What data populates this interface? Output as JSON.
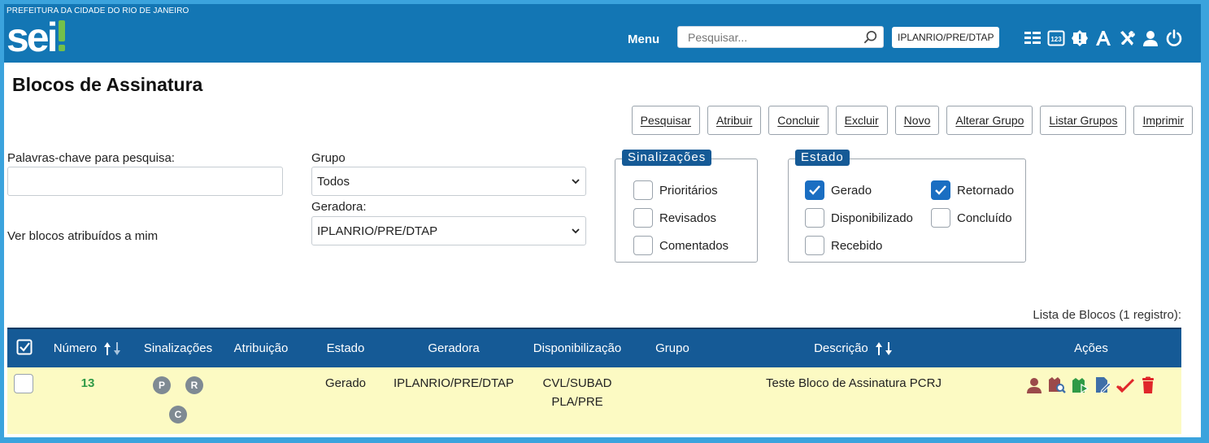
{
  "header": {
    "org_name": "PREFEITURA DA CIDADE DO RIO DE JANEIRO",
    "logo_text": "sei!",
    "menu_label": "Menu",
    "search_placeholder": "Pesquisar...",
    "unit": "IPLANRIO/PRE/DTAP",
    "icons": [
      "list-icon",
      "numeric-icon",
      "badge-alert-icon",
      "font-icon",
      "tools-icon",
      "user-icon",
      "power-icon"
    ]
  },
  "page": {
    "title": "Blocos de Assinatura"
  },
  "toolbar": {
    "buttons": [
      "Pesquisar",
      "Atribuir",
      "Concluir",
      "Excluir",
      "Novo",
      "Alterar Grupo",
      "Listar Grupos",
      "Imprimir"
    ]
  },
  "filters": {
    "keywords_label": "Palavras-chave para pesquisa:",
    "keywords_value": "",
    "assigned_label": "Ver blocos atribuídos a mim",
    "group_label": "Grupo",
    "group_value": "Todos",
    "generator_label": "Geradora:",
    "generator_value": "IPLANRIO/PRE/DTAP"
  },
  "sinalizacoes": {
    "legend": "Sinalizações",
    "options": [
      {
        "label": "Prioritários",
        "checked": false
      },
      {
        "label": "Revisados",
        "checked": false
      },
      {
        "label": "Comentados",
        "checked": false
      }
    ]
  },
  "estado": {
    "legend": "Estado",
    "options": [
      {
        "label": "Gerado",
        "checked": true
      },
      {
        "label": "Disponibilizado",
        "checked": false
      },
      {
        "label": "Recebido",
        "checked": false
      },
      {
        "label": "Retornado",
        "checked": true
      },
      {
        "label": "Concluído",
        "checked": false
      }
    ]
  },
  "table": {
    "caption": "Lista de Blocos (1 registro):",
    "columns": [
      "Número",
      "Sinalizações",
      "Atribuição",
      "Estado",
      "Geradora",
      "Disponibilização",
      "Grupo",
      "Descrição",
      "Ações"
    ],
    "rows": [
      {
        "numero": "13",
        "sinalizacoes": [
          "P",
          "R",
          "C"
        ],
        "atribuicao": "",
        "estado": "Gerado",
        "geradora": "IPLANRIO/PRE/DTAP",
        "disponibilizacao_1": "CVL/SUBAD",
        "disponibilizacao_2": "PLA/PRE",
        "grupo": "",
        "descricao": "Teste Bloco de Assinatura PCRJ"
      }
    ],
    "action_icons": [
      "assign-user-icon",
      "view-documents-icon",
      "add-document-icon",
      "sign-document-icon",
      "conclude-check-icon",
      "delete-icon"
    ]
  },
  "colors": {
    "header_bg": "#1376b4",
    "border_bg": "#3ba3dd",
    "legend_bg": "#155a96",
    "row_bg": "#fcfac3",
    "number_green": "#2f9a46",
    "action_red": "#e0262a"
  }
}
